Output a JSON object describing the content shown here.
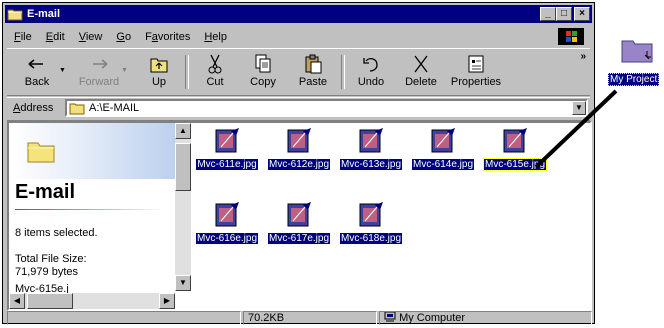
{
  "window": {
    "title": "E-mail",
    "controls": {
      "minimize": "_",
      "maximize": "□",
      "close": "×"
    }
  },
  "menu": {
    "items": [
      {
        "u": "F",
        "rest": "ile"
      },
      {
        "u": "E",
        "rest": "dit"
      },
      {
        "u": "V",
        "rest": "iew"
      },
      {
        "u": "G",
        "rest": "o"
      },
      {
        "pre": "F",
        "u": "a",
        "rest": "vorites"
      },
      {
        "u": "H",
        "rest": "elp"
      }
    ]
  },
  "toolbar": {
    "back": "Back",
    "forward": "Forward",
    "up": "Up",
    "cut": "Cut",
    "copy": "Copy",
    "paste": "Paste",
    "undo": "Undo",
    "delete": "Delete",
    "properties": "Properties",
    "more": "»"
  },
  "address": {
    "label_u": "A",
    "label_rest": "ddress",
    "value": "A:\\E-MAIL"
  },
  "left_pane": {
    "title": "E-mail",
    "selected": "8 items selected.",
    "size_label": "Total File Size:",
    "size_value": "71,979 bytes",
    "extra": "Mvc-615e.j"
  },
  "files": [
    "Mvc-611e.jpg",
    "Mvc-612e.jpg",
    "Mvc-613e.jpg",
    "Mvc-614e.jpg",
    "Mvc-615e.jpg",
    "Mvc-616e.jpg",
    "Mvc-617e.jpg",
    "Mvc-618e.jpg"
  ],
  "status": {
    "size": "70.2KB",
    "zone": "My Computer"
  },
  "desktop": {
    "label": "My Project"
  },
  "colors": {
    "titlebar": "#000080",
    "face": "#c0c0c0",
    "selection": "#000080",
    "folder": "#e8d870"
  }
}
